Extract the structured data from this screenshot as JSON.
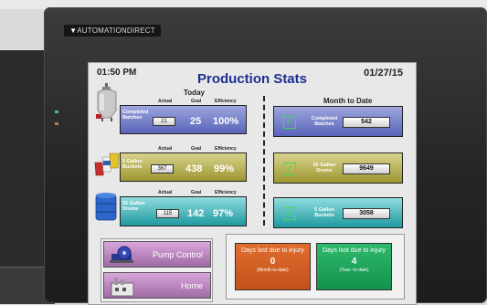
{
  "device": {
    "brand": "AUTOMATIONDIRECT",
    "led_colors": [
      "#3fbf9f",
      "#c07a3c"
    ]
  },
  "header": {
    "time": "01:50 PM",
    "title": "Production Stats",
    "date": "01/27/15"
  },
  "today": {
    "heading": "Today",
    "columns": [
      "Actual",
      "Goal",
      "Efficiency"
    ],
    "rows": [
      {
        "label": "Completed Batches",
        "actual": "21",
        "goal": "25",
        "efficiency": "100%",
        "color": "#6b74c4",
        "icon": "mixing-tank-icon"
      },
      {
        "label": "5 Gallon Buckets",
        "actual": "367",
        "goal": "438",
        "efficiency": "99%",
        "color": "#b1ab45",
        "icon": "buckets-icon"
      },
      {
        "label": "55 Gallon Drums",
        "actual": "115",
        "goal": "142",
        "efficiency": "97%",
        "color": "#2fa9ae",
        "icon": "drums-icon"
      }
    ]
  },
  "month_to_date": {
    "heading": "Month to Date",
    "rows": [
      {
        "label": "Completed Batches",
        "value": "542",
        "icon": "checkbox-icon"
      },
      {
        "label": "55 Gallon Drums",
        "value": "9649",
        "icon": "checkbox-icon"
      },
      {
        "label": "5 Gallon Buckets",
        "value": "3058",
        "icon": "checkbox-icon"
      }
    ]
  },
  "nav": {
    "pump_control": "Pump Control",
    "home": "Home"
  },
  "days_lost": {
    "month": {
      "label": "Days lost due to injury",
      "value": "0",
      "sub": "(Month-to-date)",
      "color": "#d15e23"
    },
    "year": {
      "label": "Days lost due to injury",
      "value": "4",
      "sub": "(Year- to-date)",
      "color": "#1ea65c"
    }
  }
}
